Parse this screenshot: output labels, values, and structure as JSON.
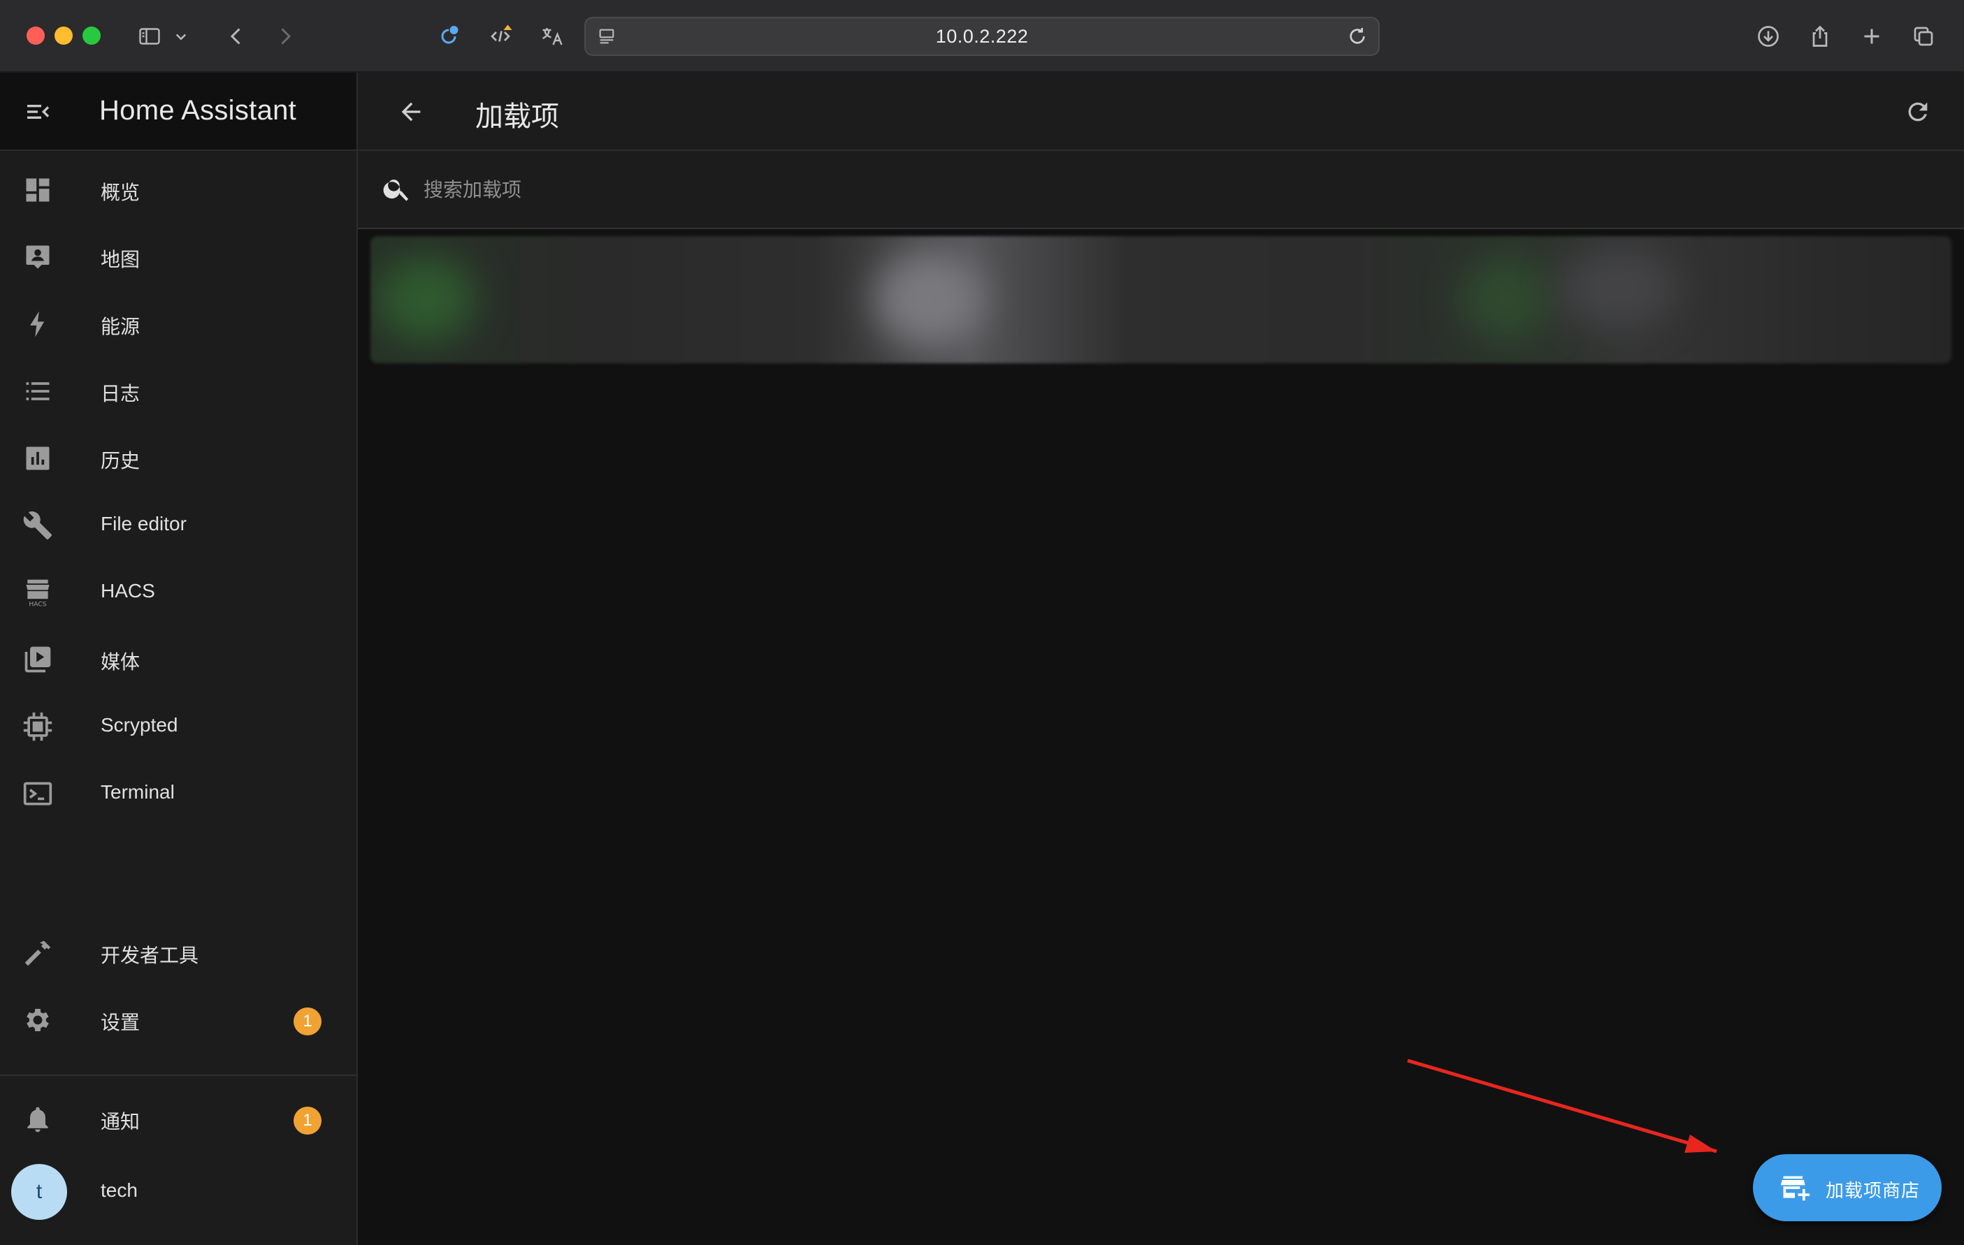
{
  "browser": {
    "url": "10.0.2.222"
  },
  "sidebar": {
    "title": "Home Assistant",
    "items": [
      {
        "label": "概览",
        "icon": "dashboard-icon"
      },
      {
        "label": "地图",
        "icon": "map-account-icon"
      },
      {
        "label": "能源",
        "icon": "lightning-icon"
      },
      {
        "label": "日志",
        "icon": "list-icon"
      },
      {
        "label": "历史",
        "icon": "chart-box-icon"
      },
      {
        "label": "File editor",
        "icon": "wrench-icon"
      },
      {
        "label": "HACS",
        "icon": "hacs-icon"
      },
      {
        "label": "媒体",
        "icon": "play-box-multiple-icon"
      },
      {
        "label": "Scrypted",
        "icon": "chip-icon"
      },
      {
        "label": "Terminal",
        "icon": "console-icon"
      }
    ],
    "bottom_items": [
      {
        "label": "开发者工具",
        "icon": "hammer-icon"
      },
      {
        "label": "设置",
        "icon": "gear-icon",
        "badge": "1"
      }
    ],
    "notifications": {
      "label": "通知",
      "badge": "1"
    },
    "user": {
      "initial": "t",
      "name": "tech"
    }
  },
  "main": {
    "title": "加载项",
    "search": {
      "placeholder": "搜索加载项",
      "value": ""
    },
    "store_button": "加载项商店"
  },
  "colors": {
    "accent": "#3b9be8",
    "badge": "#f0a333",
    "arrow": "#e8261f"
  }
}
